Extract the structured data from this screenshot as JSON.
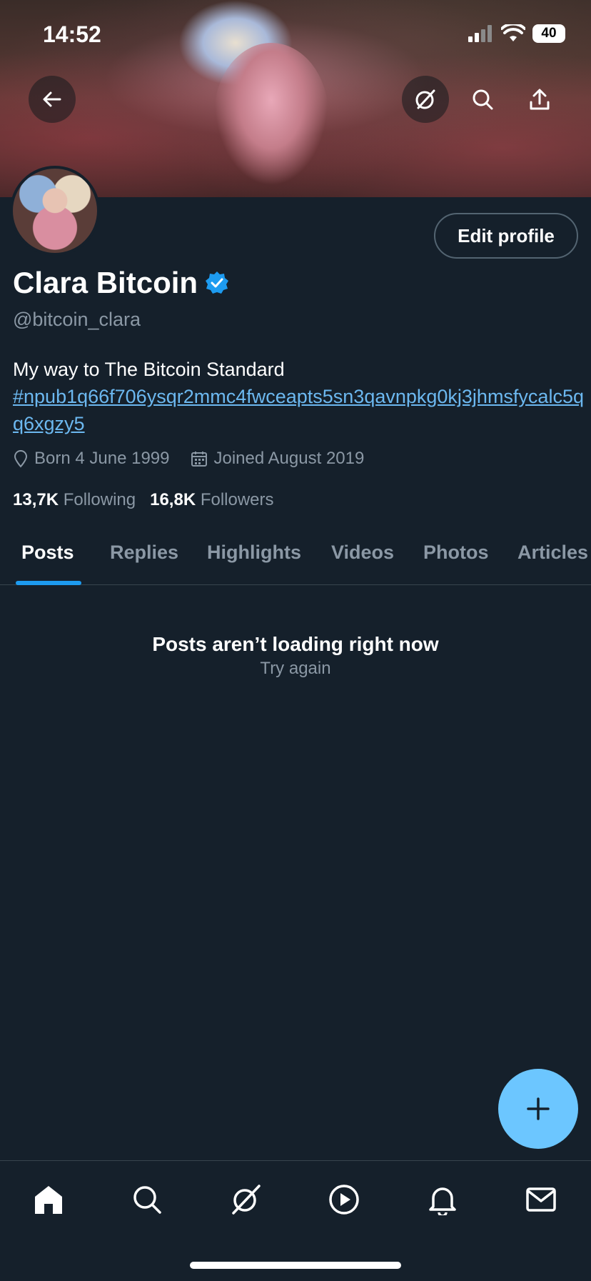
{
  "status_bar": {
    "time": "14:52",
    "battery": "40"
  },
  "profile": {
    "name": "Clara Bitcoin",
    "handle": "@bitcoin_clara",
    "bio_text": "My way to The Bitcoin Standard",
    "bio_link": "#npub1q66f706ysqr2mmc4fwceapts5sn3qavnpkg0kj3jhmsfycalc5qq6xgzy5",
    "born": "Born 4 June 1999",
    "joined": "Joined August 2019",
    "following_count": "13,7K",
    "following_label": "Following",
    "followers_count": "16,8K",
    "followers_label": "Followers",
    "edit_label": "Edit profile"
  },
  "tabs": [
    {
      "label": "Posts",
      "active": true
    },
    {
      "label": "Replies"
    },
    {
      "label": "Highlights"
    },
    {
      "label": "Videos"
    },
    {
      "label": "Photos"
    },
    {
      "label": "Articles"
    }
  ],
  "feed": {
    "empty_title": "Posts aren’t loading right now",
    "retry_label": "Try again"
  },
  "icons": {
    "header": [
      "back-arrow-icon",
      "grok-icon",
      "search-icon",
      "share-icon"
    ],
    "nav": [
      "home-icon",
      "search-icon",
      "grok-icon",
      "play-icon",
      "bell-icon",
      "mail-icon"
    ],
    "fab": "plus-icon"
  },
  "colors": {
    "background": "#15202b",
    "accent": "#1d9bf0",
    "fab": "#6cc6ff",
    "muted": "#8b98a5"
  }
}
